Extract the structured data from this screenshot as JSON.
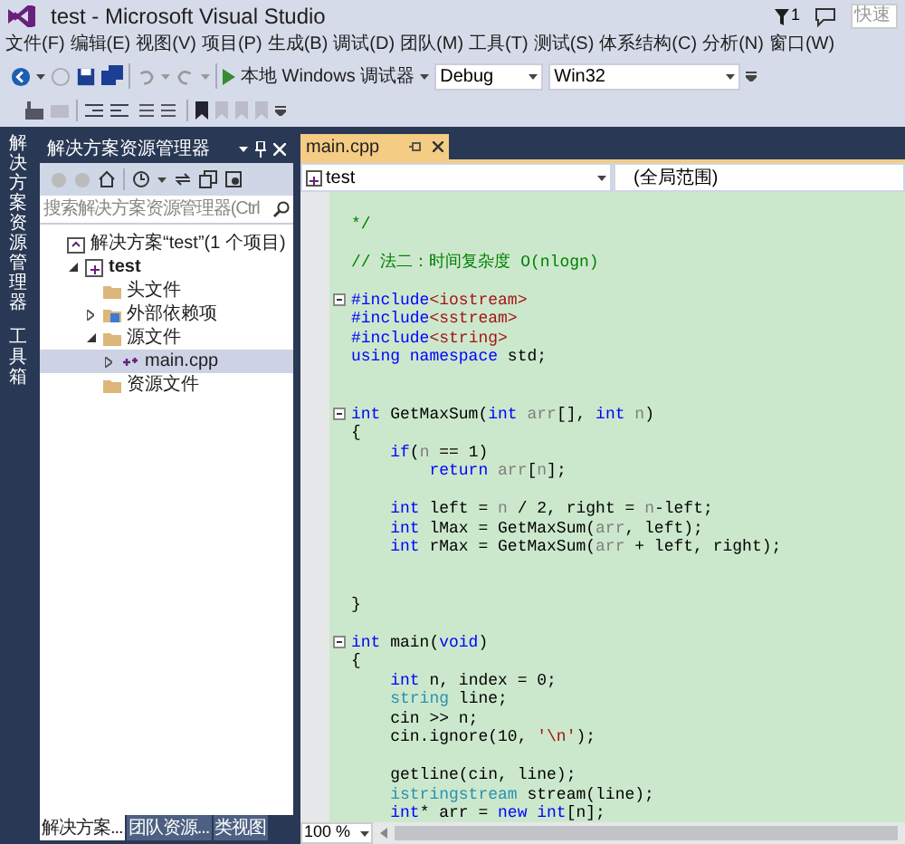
{
  "window": {
    "title": "test - Microsoft Visual Studio",
    "notification_count": "1",
    "quick_launch": {
      "placeholder": "快速"
    }
  },
  "menu": [
    "文件(F)",
    "编辑(E)",
    "视图(V)",
    "项目(P)",
    "生成(B)",
    "调试(D)",
    "团队(M)",
    "工具(T)",
    "测试(S)",
    "体系结构(C)",
    "分析(N)",
    "窗口(W)"
  ],
  "toolbar": {
    "debugger": "本地 Windows 调试器",
    "configuration": "Debug",
    "platform": "Win32"
  },
  "side_strip": [
    "解决方案资源管理器",
    "工具箱"
  ],
  "solution_explorer": {
    "title": "解决方案资源管理器",
    "search": {
      "placeholder": "搜索解决方案资源管理器(Ctrl"
    },
    "tree": [
      {
        "kind": "solution",
        "label": "解决方案“test”(1 个项目)",
        "selected": false,
        "children": [
          {
            "kind": "project",
            "label": "test",
            "expanded": true,
            "selected": false,
            "children": [
              {
                "kind": "folder",
                "label": "头文件",
                "selected": false
              },
              {
                "kind": "references",
                "label": "外部依赖项",
                "expanded": false,
                "selected": false
              },
              {
                "kind": "folder",
                "label": "源文件",
                "expanded": true,
                "selected": false,
                "children": [
                  {
                    "kind": "file",
                    "label": "main.cpp",
                    "expanded": false,
                    "selected": true
                  }
                ]
              },
              {
                "kind": "folder",
                "label": "资源文件",
                "selected": false
              }
            ]
          }
        ]
      }
    ],
    "tabs": [
      {
        "label": "解决方案...",
        "selected": true
      },
      {
        "label": "团队资源...",
        "selected": false
      },
      {
        "label": "类视图",
        "selected": false
      }
    ]
  },
  "editor": {
    "tabs": [
      {
        "label": "main.cpp",
        "selected": true
      }
    ],
    "project": "test",
    "scope": "(全局范围)",
    "zoom": "100 %",
    "lines": [
      {
        "fold": false
      },
      {
        "fold": false,
        "tokens": [
          {
            "kind": "comment",
            "text": "*/"
          }
        ]
      },
      {
        "fold": false
      },
      {
        "fold": false,
        "tokens": [
          {
            "kind": "comment",
            "text": "// 法二：时间复杂度 O(nlogn)"
          }
        ]
      },
      {
        "fold": false
      },
      {
        "fold": true,
        "tokens": [
          {
            "kind": "keyword",
            "text": "#include"
          },
          {
            "kind": "string",
            "text": "<iostream>"
          }
        ]
      },
      {
        "fold": false,
        "tokens": [
          {
            "kind": "keyword",
            "text": "#include"
          },
          {
            "kind": "string",
            "text": "<sstream>"
          }
        ]
      },
      {
        "fold": false,
        "tokens": [
          {
            "kind": "keyword",
            "text": "#include"
          },
          {
            "kind": "string",
            "text": "<string>"
          }
        ]
      },
      {
        "fold": false,
        "tokens": [
          {
            "kind": "keyword",
            "text": "using namespace"
          },
          {
            "kind": "plain",
            "text": " std;"
          }
        ]
      },
      {
        "fold": false
      },
      {
        "fold": false
      },
      {
        "fold": true,
        "tokens": [
          {
            "kind": "keyword",
            "text": "int"
          },
          {
            "kind": "plain",
            "text": " GetMaxSum("
          },
          {
            "kind": "keyword",
            "text": "int"
          },
          {
            "kind": "param",
            "text": " arr"
          },
          {
            "kind": "plain",
            "text": "[], "
          },
          {
            "kind": "keyword",
            "text": "int"
          },
          {
            "kind": "param",
            "text": " n"
          },
          {
            "kind": "plain",
            "text": ")"
          }
        ]
      },
      {
        "fold": false,
        "tokens": [
          {
            "kind": "plain",
            "text": "{"
          }
        ]
      },
      {
        "fold": false,
        "tokens": [
          {
            "kind": "keyword",
            "text": "    if"
          },
          {
            "kind": "plain",
            "text": "("
          },
          {
            "kind": "param",
            "text": "n"
          },
          {
            "kind": "plain",
            "text": " == 1)"
          }
        ]
      },
      {
        "fold": false,
        "tokens": [
          {
            "kind": "keyword",
            "text": "        return"
          },
          {
            "kind": "param",
            "text": " arr"
          },
          {
            "kind": "plain",
            "text": "["
          },
          {
            "kind": "param",
            "text": "n"
          },
          {
            "kind": "plain",
            "text": "];"
          }
        ]
      },
      {
        "fold": false
      },
      {
        "fold": false,
        "tokens": [
          {
            "kind": "keyword",
            "text": "    int"
          },
          {
            "kind": "plain",
            "text": " left = "
          },
          {
            "kind": "param",
            "text": "n"
          },
          {
            "kind": "plain",
            "text": " / 2, right = "
          },
          {
            "kind": "param",
            "text": "n"
          },
          {
            "kind": "plain",
            "text": "-left;"
          }
        ]
      },
      {
        "fold": false,
        "tokens": [
          {
            "kind": "keyword",
            "text": "    int"
          },
          {
            "kind": "plain",
            "text": " lMax = GetMaxSum("
          },
          {
            "kind": "param",
            "text": "arr"
          },
          {
            "kind": "plain",
            "text": ", left);"
          }
        ]
      },
      {
        "fold": false,
        "tokens": [
          {
            "kind": "keyword",
            "text": "    int"
          },
          {
            "kind": "plain",
            "text": " rMax = GetMaxSum("
          },
          {
            "kind": "param",
            "text": "arr"
          },
          {
            "kind": "plain",
            "text": " + left, right);"
          }
        ]
      },
      {
        "fold": false
      },
      {
        "fold": false
      },
      {
        "fold": false,
        "tokens": [
          {
            "kind": "plain",
            "text": "}"
          }
        ]
      },
      {
        "fold": false
      },
      {
        "fold": true,
        "tokens": [
          {
            "kind": "keyword",
            "text": "int"
          },
          {
            "kind": "plain",
            "text": " main("
          },
          {
            "kind": "keyword",
            "text": "void"
          },
          {
            "kind": "plain",
            "text": ")"
          }
        ]
      },
      {
        "fold": false,
        "tokens": [
          {
            "kind": "plain",
            "text": "{"
          }
        ]
      },
      {
        "fold": false,
        "tokens": [
          {
            "kind": "keyword",
            "text": "    int"
          },
          {
            "kind": "plain",
            "text": " n, index = 0;"
          }
        ]
      },
      {
        "fold": false,
        "tokens": [
          {
            "kind": "type",
            "text": "    string"
          },
          {
            "kind": "plain",
            "text": " line;"
          }
        ]
      },
      {
        "fold": false,
        "tokens": [
          {
            "kind": "plain",
            "text": "    cin >> n;"
          }
        ]
      },
      {
        "fold": false,
        "tokens": [
          {
            "kind": "plain",
            "text": "    cin.ignore(10, "
          },
          {
            "kind": "string",
            "text": "'\\n'"
          },
          {
            "kind": "plain",
            "text": ");"
          }
        ]
      },
      {
        "fold": false
      },
      {
        "fold": false,
        "tokens": [
          {
            "kind": "plain",
            "text": "    getline(cin, line);"
          }
        ]
      },
      {
        "fold": false,
        "tokens": [
          {
            "kind": "type",
            "text": "    istringstream"
          },
          {
            "kind": "plain",
            "text": " stream(line);"
          }
        ]
      },
      {
        "fold": false,
        "tokens": [
          {
            "kind": "keyword",
            "text": "    int"
          },
          {
            "kind": "plain",
            "text": "* arr = "
          },
          {
            "kind": "keyword",
            "text": "new int"
          },
          {
            "kind": "plain",
            "text": "[n];"
          }
        ]
      }
    ]
  }
}
